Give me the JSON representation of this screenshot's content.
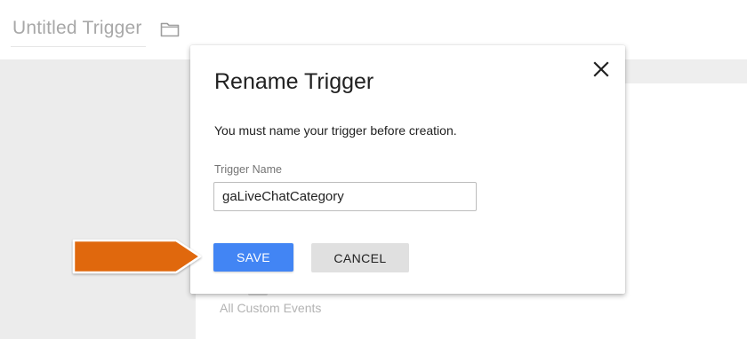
{
  "page": {
    "title": "Untitled Trigger",
    "folder_icon": "folder-icon",
    "background_item": "All Custom Events"
  },
  "dialog": {
    "title": "Rename Trigger",
    "close_icon": "close-icon",
    "message": "You must name your trigger before creation.",
    "field_label": "Trigger Name",
    "field_value": "gaLiveChatCategory",
    "save_label": "SAVE",
    "cancel_label": "CANCEL"
  },
  "annotation": {
    "arrow_icon": "arrow-right-icon",
    "color": "#e0670f"
  },
  "colors": {
    "primary": "#4285f4",
    "secondary_button": "#e0e0e0"
  }
}
